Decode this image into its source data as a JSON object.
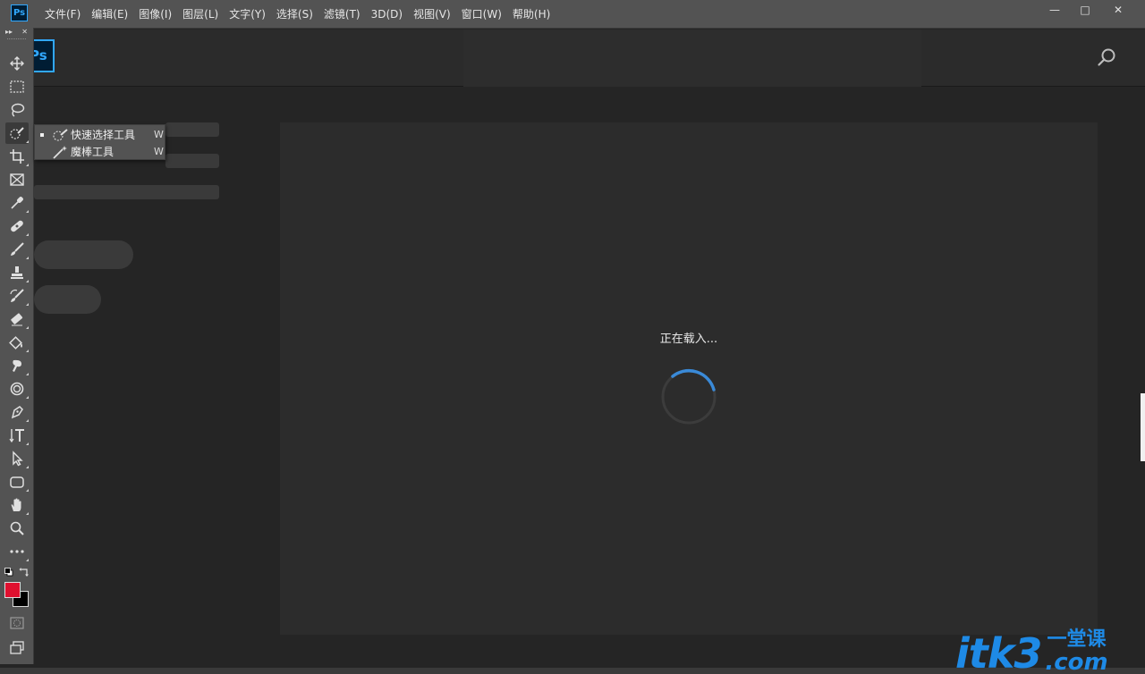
{
  "app": {
    "logo_small": "Ps",
    "logo_big": "Ps"
  },
  "menu": [
    {
      "label": "文件(F)"
    },
    {
      "label": "编辑(E)"
    },
    {
      "label": "图像(I)"
    },
    {
      "label": "图层(L)"
    },
    {
      "label": "文字(Y)"
    },
    {
      "label": "选择(S)"
    },
    {
      "label": "滤镜(T)"
    },
    {
      "label": "3D(D)"
    },
    {
      "label": "视图(V)"
    },
    {
      "label": "窗口(W)"
    },
    {
      "label": "帮助(H)"
    }
  ],
  "window_controls": {
    "minimize": "—",
    "maximize": "□",
    "close": "✕"
  },
  "toolbar": {
    "collapse": "▸▸",
    "close": "✕",
    "tools": [
      {
        "name": "move-tool",
        "icon": "move-icon"
      },
      {
        "name": "marquee-tool",
        "icon": "rect-marquee-icon"
      },
      {
        "name": "lasso-tool",
        "icon": "lasso-icon"
      },
      {
        "name": "quick-selection-tool",
        "icon": "quick-selection-icon",
        "active": true
      },
      {
        "name": "crop-tool",
        "icon": "crop-icon"
      },
      {
        "name": "frame-tool",
        "icon": "frame-icon"
      },
      {
        "name": "eyedropper-tool",
        "icon": "eyedropper-icon"
      },
      {
        "name": "healing-tool",
        "icon": "healing-icon"
      },
      {
        "name": "brush-tool",
        "icon": "brush-icon"
      },
      {
        "name": "clone-stamp-tool",
        "icon": "stamp-icon"
      },
      {
        "name": "history-brush-tool",
        "icon": "history-brush-icon"
      },
      {
        "name": "eraser-tool",
        "icon": "eraser-icon"
      },
      {
        "name": "paint-bucket-tool",
        "icon": "bucket-icon"
      },
      {
        "name": "smudge-tool",
        "icon": "smudge-icon"
      },
      {
        "name": "dodge-tool",
        "icon": "dodge-icon"
      },
      {
        "name": "pen-tool",
        "icon": "pen-icon"
      },
      {
        "name": "type-tool",
        "icon": "type-icon"
      },
      {
        "name": "path-selection-tool",
        "icon": "arrow-icon"
      },
      {
        "name": "shape-tool",
        "icon": "rounded-rect-icon"
      },
      {
        "name": "hand-tool",
        "icon": "hand-icon"
      },
      {
        "name": "zoom-tool",
        "icon": "zoom-icon"
      },
      {
        "name": "more-tools",
        "icon": "ellipsis-icon"
      }
    ],
    "foreground_color": "#e0102f",
    "background_color": "#000000"
  },
  "flyout": {
    "items": [
      {
        "label": "快速选择工具",
        "shortcut": "W",
        "selected": true,
        "icon": "quick-selection-icon"
      },
      {
        "label": "魔棒工具",
        "shortcut": "W",
        "selected": false,
        "icon": "magic-wand-icon"
      }
    ]
  },
  "loading": {
    "text": "正在载入..."
  },
  "watermark": {
    "main": "itk3",
    "cn": "一堂课",
    "com": ".com"
  },
  "colors": {
    "accent": "#31a8ff",
    "spinner": "#3a8ad8",
    "watermark": "#1e8ae6"
  }
}
